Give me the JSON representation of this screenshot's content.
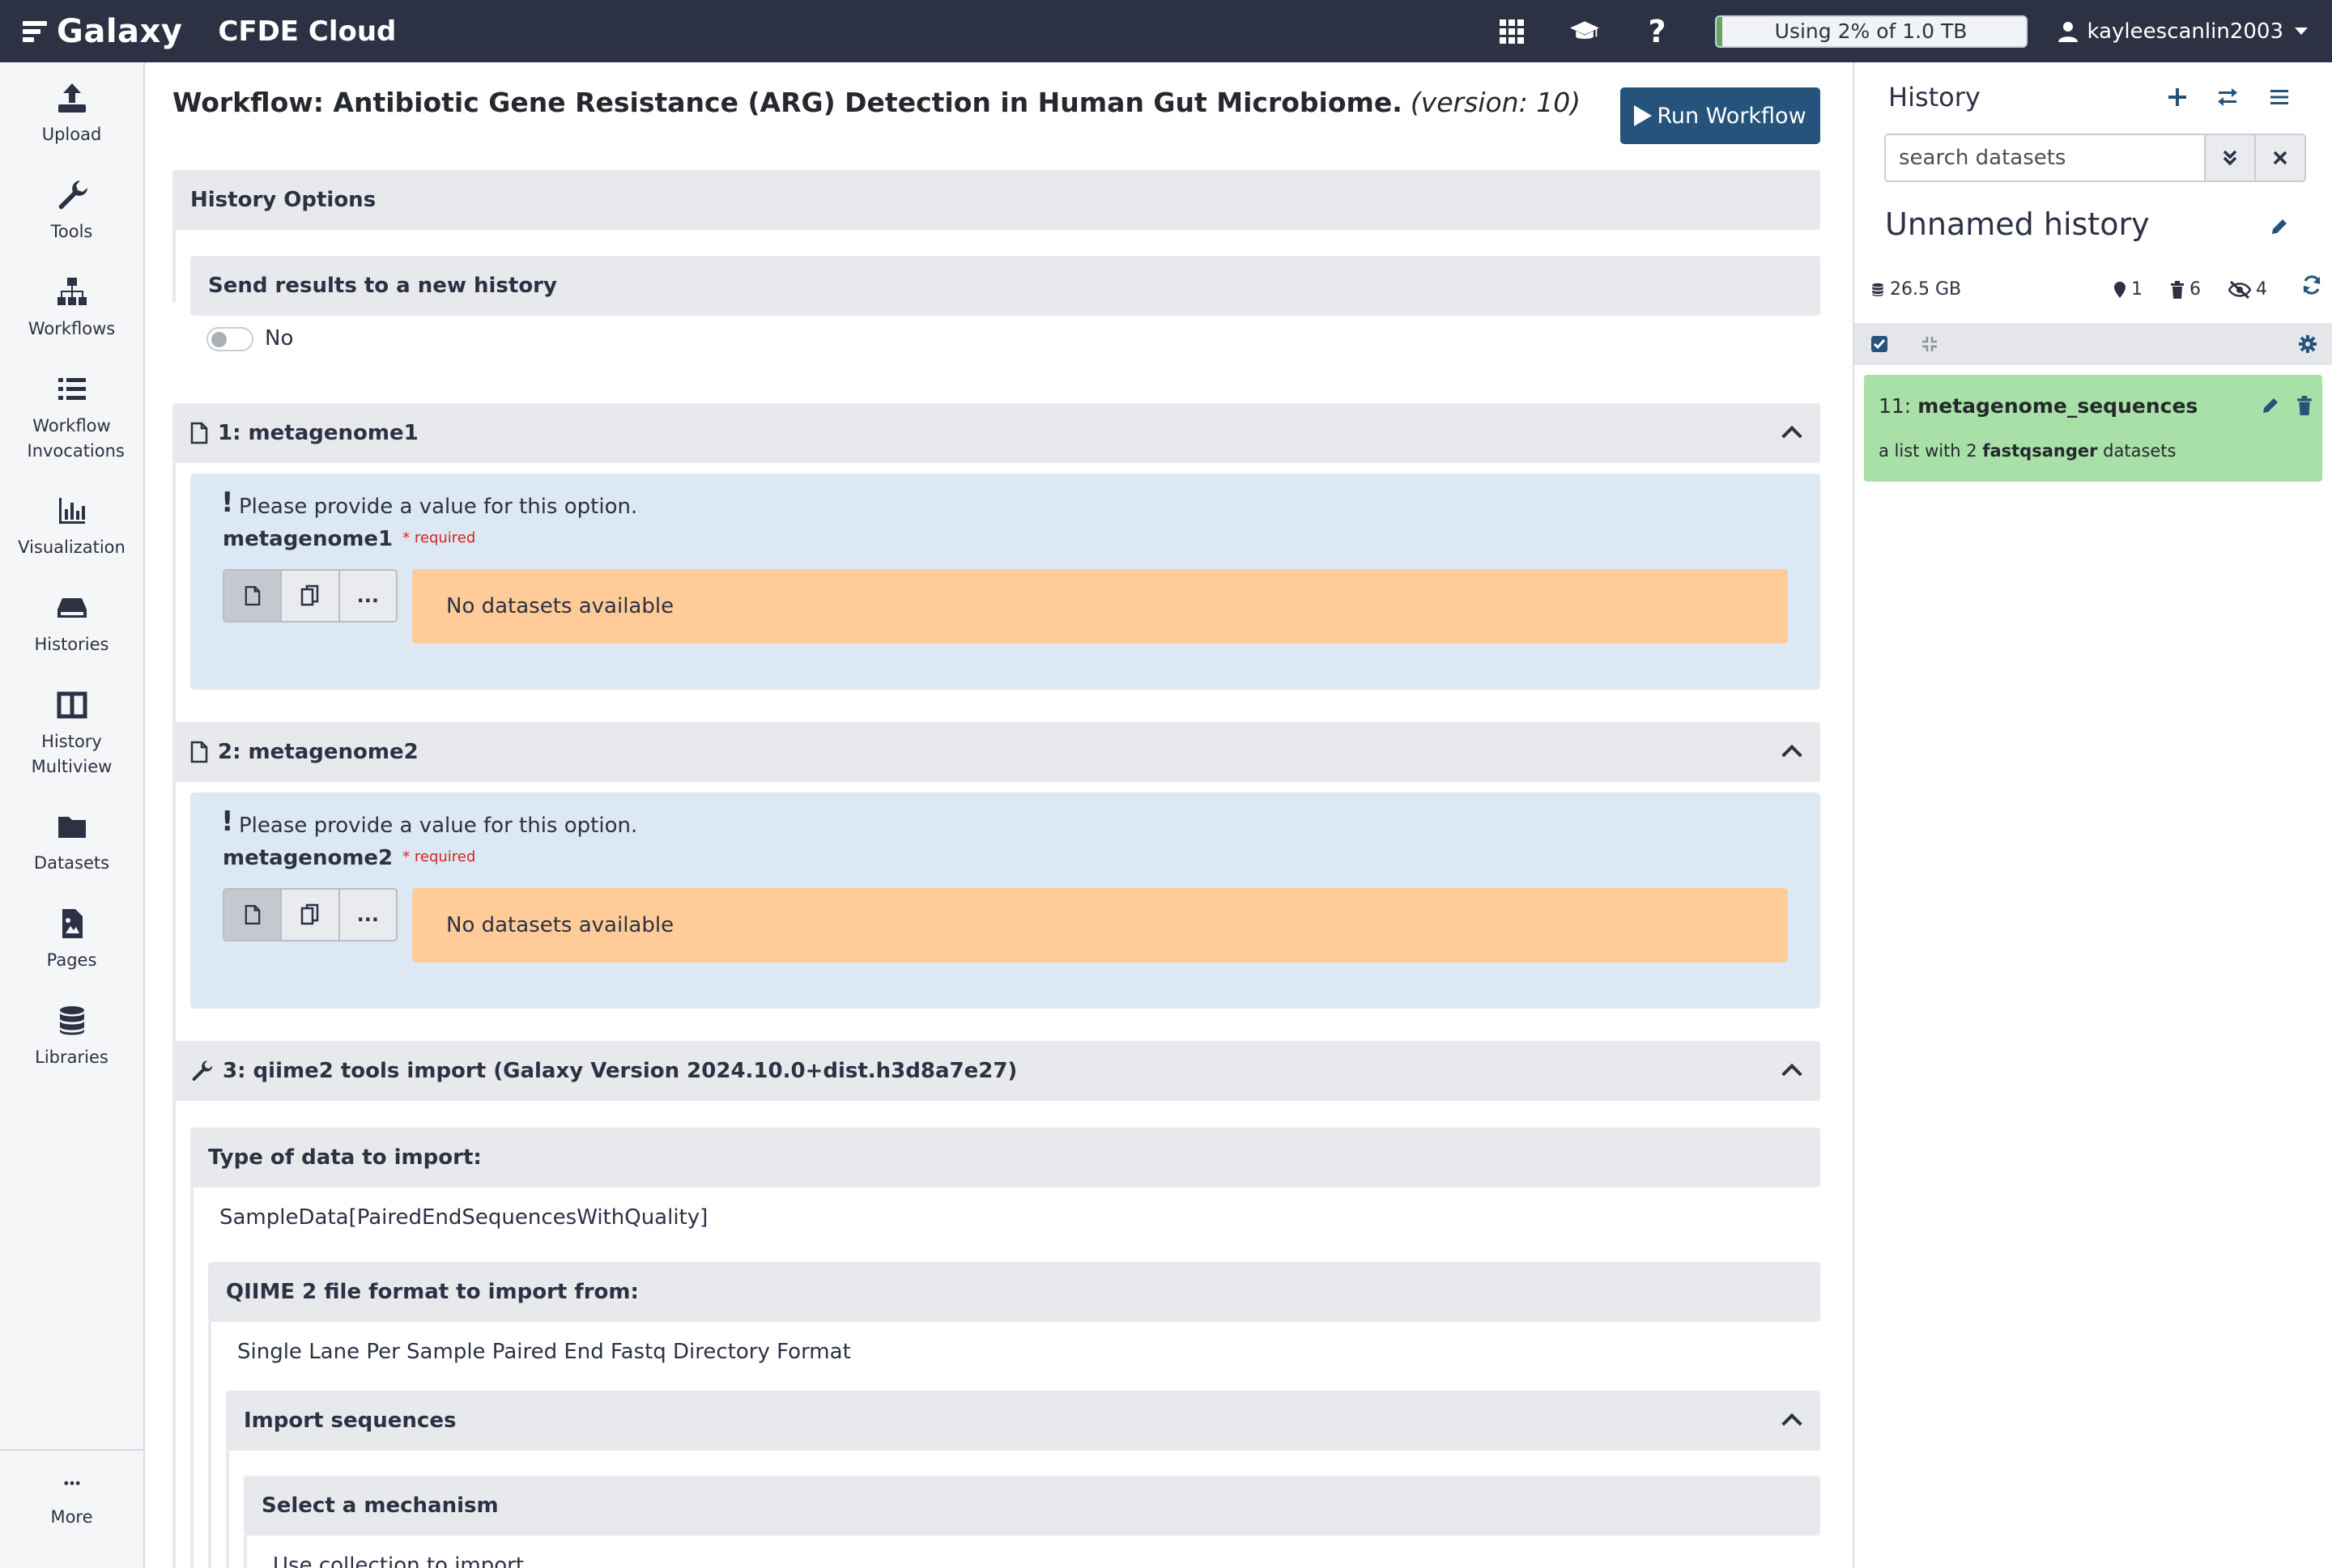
{
  "navbar": {
    "brand": "Galaxy",
    "instance": "CFDE Cloud",
    "quota_text": "Using 2% of 1.0 TB",
    "quota_percent": 2,
    "username": "kayleescanlin2003",
    "icons": [
      "apps-grid-icon",
      "graduation-cap-icon",
      "help-icon",
      "user-icon"
    ]
  },
  "activity_bar": {
    "items": [
      {
        "label": "Upload",
        "icon": "upload-icon"
      },
      {
        "label": "Tools",
        "icon": "wrench-icon"
      },
      {
        "label": "Workflows",
        "icon": "sitemap-icon"
      },
      {
        "label": "Workflow Invocations",
        "icon": "list-icon"
      },
      {
        "label": "Visualization",
        "icon": "chart-icon"
      },
      {
        "label": "Histories",
        "icon": "hdd-icon"
      },
      {
        "label": "History Multiview",
        "icon": "columns-icon"
      },
      {
        "label": "Datasets",
        "icon": "folder-icon"
      },
      {
        "label": "Pages",
        "icon": "file-image-icon"
      },
      {
        "label": "Libraries",
        "icon": "database-icon"
      }
    ],
    "more_label": "More"
  },
  "workflow": {
    "title": "Workflow: Antibiotic Gene Resistance (ARG) Detection in Human Gut Microbiome.",
    "version": "(version: 10)",
    "run_label": "Run Workflow",
    "history_options": {
      "title": "History Options",
      "send_label": "Send results to a new history",
      "send_value": "No"
    },
    "inputs": [
      {
        "header": "1: metagenome1",
        "warning": "Please provide a value for this option.",
        "field": "metagenome1",
        "required": "required",
        "empty": "No datasets available"
      },
      {
        "header": "2: metagenome2",
        "warning": "Please provide a value for this option.",
        "field": "metagenome2",
        "required": "required",
        "empty": "No datasets available"
      }
    ],
    "tool_step": {
      "header": "3: qiime2 tools import (Galaxy Version 2024.10.0+dist.h3d8a7e27)",
      "type_label": "Type of data to import:",
      "type_value": "SampleData[PairedEndSequencesWithQuality]",
      "format_label": "QIIME 2 file format to import from:",
      "format_value": "Single Lane Per Sample Paired End Fastq Directory Format",
      "import_label": "Import sequences",
      "mechanism_label": "Select a mechanism",
      "mechanism_value": "Use collection to import"
    }
  },
  "history": {
    "title": "History",
    "search_placeholder": "search datasets",
    "name": "Unnamed history",
    "size": "26.5 GB",
    "count_shown": "1",
    "count_deleted": "6",
    "count_hidden": "4",
    "items": [
      {
        "hid": "11:",
        "name": "metagenome_sequences",
        "desc_prefix": "a list with 2 ",
        "desc_format": "fastqsanger",
        "desc_suffix": " datasets",
        "state_color": "#a8e0a8"
      }
    ]
  },
  "colors": {
    "navbar": "#2c3143",
    "primary_button": "#25537b",
    "info_panel": "#dce8f3",
    "warning_panel": "#ffcb98",
    "ok_dataset": "#a8e0a8"
  }
}
